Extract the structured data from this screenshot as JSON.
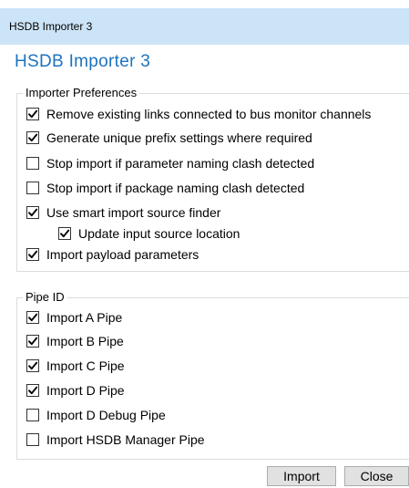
{
  "window": {
    "title": "HSDB Importer 3"
  },
  "heading": "HSDB Importer 3",
  "importer_preferences": {
    "legend": "Importer Preferences",
    "items": [
      {
        "label": "Remove existing links connected to bus monitor channels",
        "checked": true
      },
      {
        "label": "Generate unique prefix settings where required",
        "checked": true
      },
      {
        "label": "Stop import if parameter naming clash detected",
        "checked": false
      },
      {
        "label": "Stop import if package naming clash detected",
        "checked": false
      },
      {
        "label": "Use smart import source finder",
        "checked": true
      },
      {
        "label": "Update input source location",
        "checked": true
      },
      {
        "label": "Import payload parameters",
        "checked": true
      }
    ]
  },
  "pipe_id": {
    "legend": "Pipe ID",
    "items": [
      {
        "label": "Import A Pipe",
        "checked": true
      },
      {
        "label": "Import B Pipe",
        "checked": true
      },
      {
        "label": "Import C Pipe",
        "checked": true
      },
      {
        "label": "Import D Pipe",
        "checked": true
      },
      {
        "label": "Import D Debug Pipe",
        "checked": false
      },
      {
        "label": "Import HSDB Manager Pipe",
        "checked": false
      }
    ]
  },
  "buttons": {
    "import_label": "Import",
    "close_label": "Close"
  },
  "colors": {
    "titlebar": "#cce4f7",
    "heading": "#1e73be",
    "checkmark": "#000000"
  }
}
